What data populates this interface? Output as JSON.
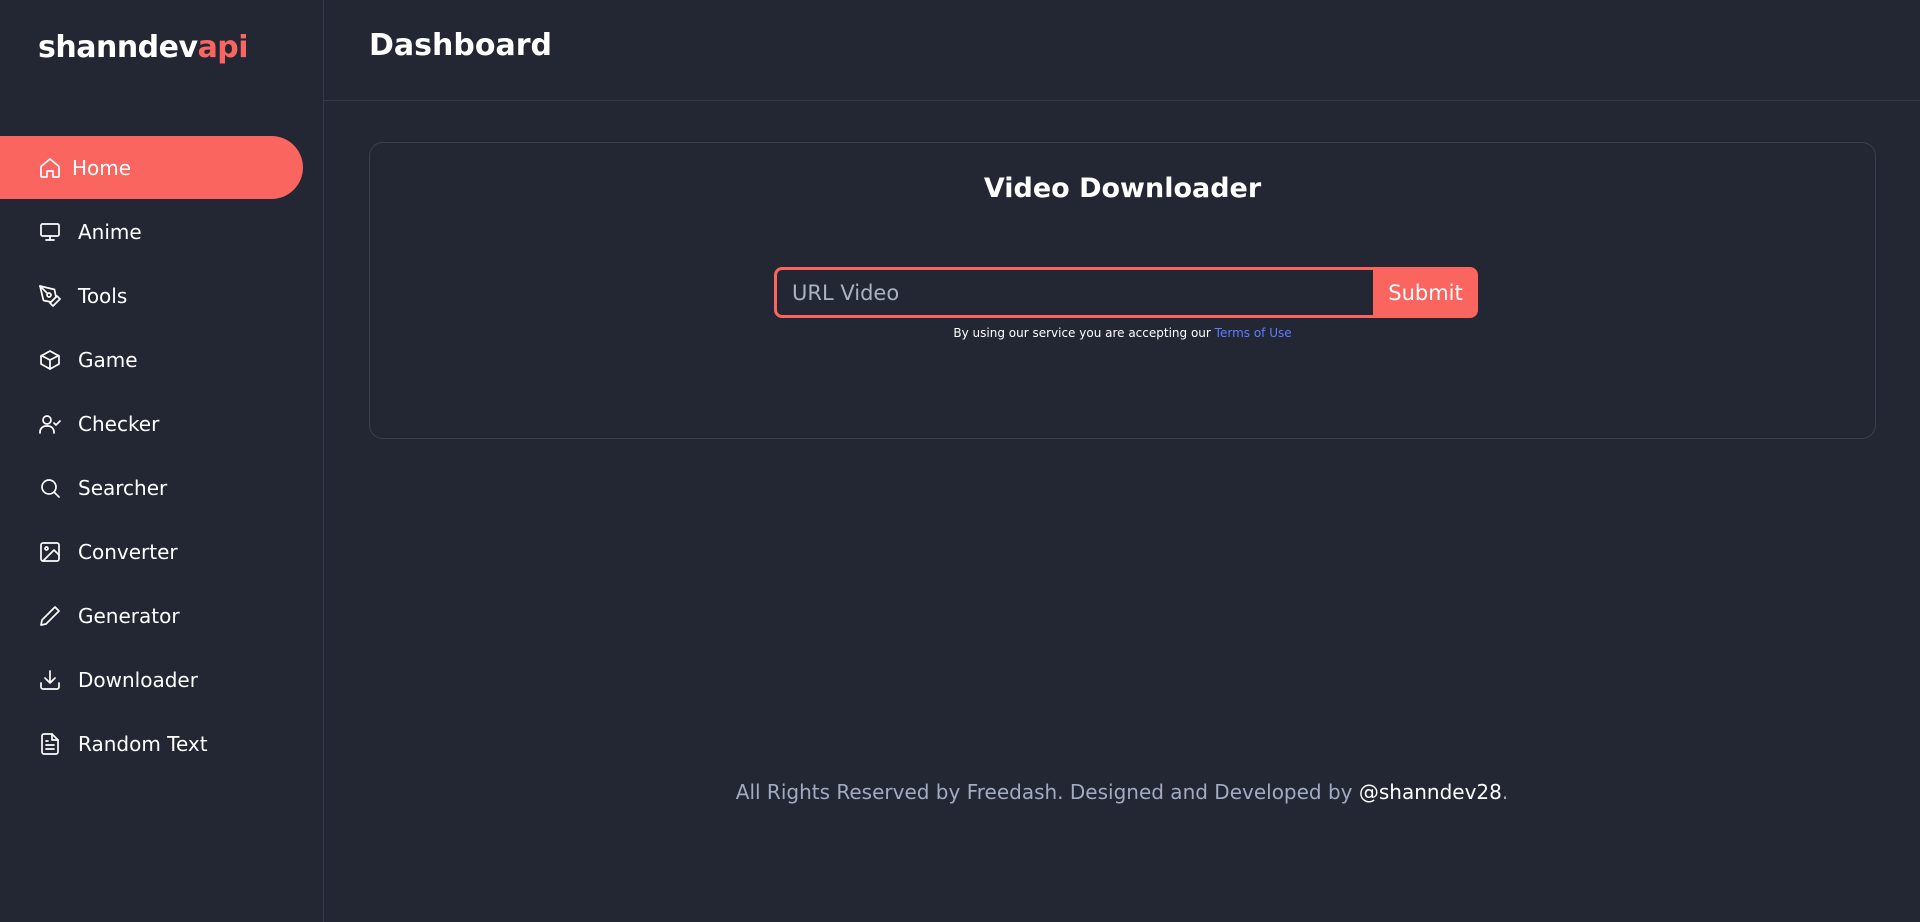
{
  "brand": {
    "name_main": "shanndev",
    "name_accent": "api",
    "accent_color": "#fa6560"
  },
  "sidebar": {
    "items": [
      {
        "label": "Home",
        "icon": "home-icon",
        "active": true
      },
      {
        "label": "Anime",
        "icon": "monitor-icon"
      },
      {
        "label": "Tools",
        "icon": "pen-tool-icon"
      },
      {
        "label": "Game",
        "icon": "package-icon"
      },
      {
        "label": "Checker",
        "icon": "user-check-icon"
      },
      {
        "label": "Searcher",
        "icon": "search-icon"
      },
      {
        "label": "Converter",
        "icon": "image-icon"
      },
      {
        "label": "Generator",
        "icon": "pencil-icon"
      },
      {
        "label": "Downloader",
        "icon": "download-icon"
      },
      {
        "label": "Random Text",
        "icon": "file-text-icon"
      }
    ]
  },
  "header": {
    "title": "Dashboard"
  },
  "card": {
    "title": "Video Downloader",
    "input_placeholder": "URL Video",
    "input_value": "",
    "submit_label": "Submit",
    "terms_prefix": "By using our service you are accepting our",
    "terms_link": "Terms of Use"
  },
  "footer": {
    "text": "All Rights Reserved by Freedash. Designed and Developed by",
    "handle": "@shanndev28",
    "suffix": "."
  },
  "colors": {
    "background": "#222733",
    "link": "#5f7cff",
    "muted_text": "#a1abc2"
  }
}
